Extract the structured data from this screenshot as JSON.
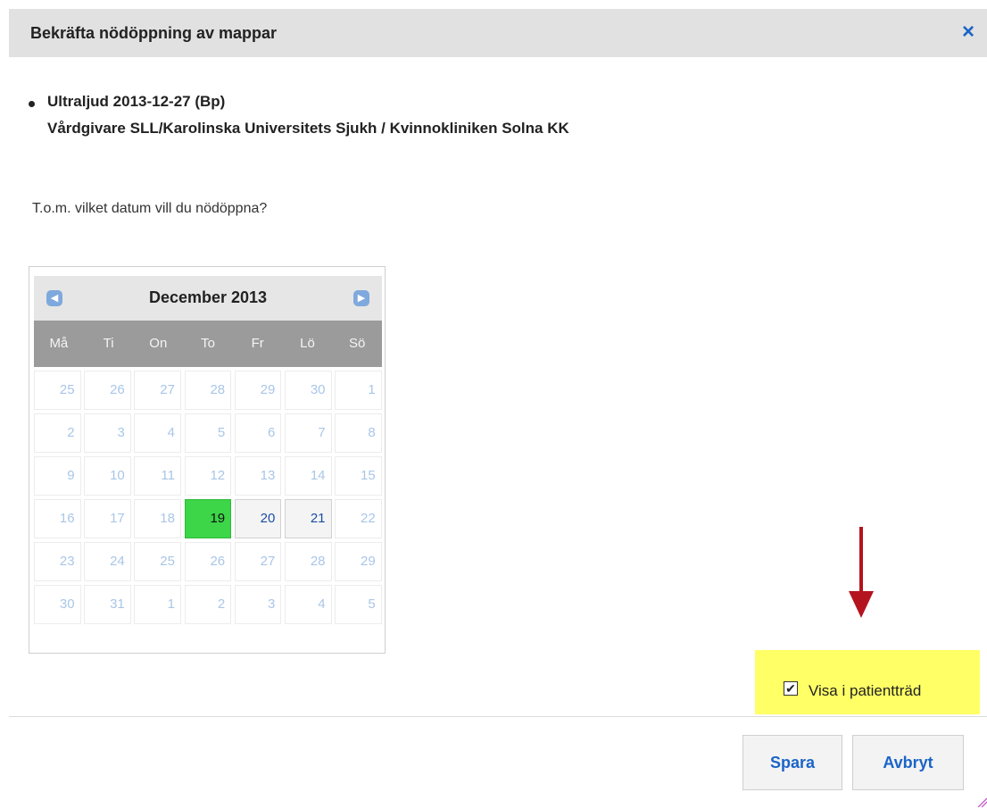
{
  "dialog": {
    "title": "Bekräfta nödöppning av mappar",
    "close_icon": "×"
  },
  "item": {
    "line1": "Ultraljud 2013-12-27 (Bp)",
    "line2": "Vårdgivare SLL/Karolinska Universitets Sjukh / Kvinnokliniken Solna KK"
  },
  "question": "T.o.m. vilket datum vill du nödöppna?",
  "calendar": {
    "month_label": "December 2013",
    "prev_icon": "◀",
    "next_icon": "▶",
    "weekdays": [
      "Må",
      "Ti",
      "On",
      "To",
      "Fr",
      "Lö",
      "Sö"
    ],
    "days": [
      {
        "n": "25",
        "s": "disabled"
      },
      {
        "n": "26",
        "s": "disabled"
      },
      {
        "n": "27",
        "s": "disabled"
      },
      {
        "n": "28",
        "s": "disabled"
      },
      {
        "n": "29",
        "s": "disabled"
      },
      {
        "n": "30",
        "s": "disabled"
      },
      {
        "n": "1",
        "s": "disabled"
      },
      {
        "n": "2",
        "s": "disabled"
      },
      {
        "n": "3",
        "s": "disabled"
      },
      {
        "n": "4",
        "s": "disabled"
      },
      {
        "n": "5",
        "s": "disabled"
      },
      {
        "n": "6",
        "s": "disabled"
      },
      {
        "n": "7",
        "s": "disabled"
      },
      {
        "n": "8",
        "s": "disabled"
      },
      {
        "n": "9",
        "s": "disabled"
      },
      {
        "n": "10",
        "s": "disabled"
      },
      {
        "n": "11",
        "s": "disabled"
      },
      {
        "n": "12",
        "s": "disabled"
      },
      {
        "n": "13",
        "s": "disabled"
      },
      {
        "n": "14",
        "s": "disabled"
      },
      {
        "n": "15",
        "s": "disabled"
      },
      {
        "n": "16",
        "s": "disabled"
      },
      {
        "n": "17",
        "s": "disabled"
      },
      {
        "n": "18",
        "s": "disabled"
      },
      {
        "n": "19",
        "s": "selected"
      },
      {
        "n": "20",
        "s": "available"
      },
      {
        "n": "21",
        "s": "available"
      },
      {
        "n": "22",
        "s": "disabled"
      },
      {
        "n": "23",
        "s": "disabled"
      },
      {
        "n": "24",
        "s": "disabled"
      },
      {
        "n": "25",
        "s": "disabled"
      },
      {
        "n": "26",
        "s": "disabled"
      },
      {
        "n": "27",
        "s": "disabled"
      },
      {
        "n": "28",
        "s": "disabled"
      },
      {
        "n": "29",
        "s": "disabled"
      },
      {
        "n": "30",
        "s": "disabled"
      },
      {
        "n": "31",
        "s": "disabled"
      },
      {
        "n": "1",
        "s": "disabled"
      },
      {
        "n": "2",
        "s": "disabled"
      },
      {
        "n": "3",
        "s": "disabled"
      },
      {
        "n": "4",
        "s": "disabled"
      },
      {
        "n": "5",
        "s": "disabled"
      }
    ]
  },
  "show_in_tree": {
    "label": "Visa i patientträd",
    "checked": true,
    "check_glyph": "✔"
  },
  "buttons": {
    "save": "Spara",
    "cancel": "Avbryt"
  },
  "colors": {
    "title_bar": "#e1e1e1",
    "accent_blue": "#1a64c8",
    "selected_day": "#3cd648",
    "highlight": "#ffff66",
    "arrow": "#b4141e"
  }
}
